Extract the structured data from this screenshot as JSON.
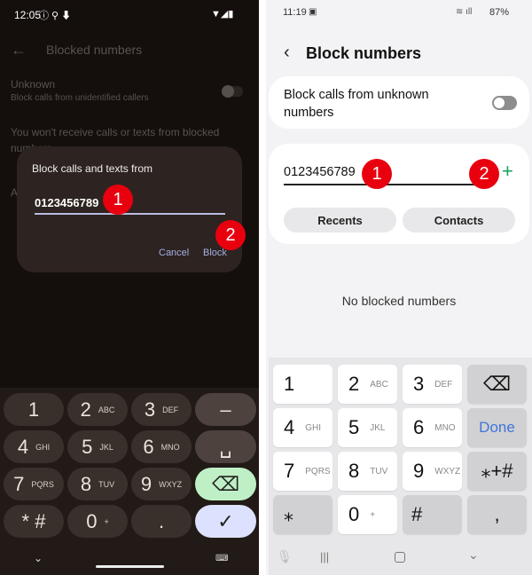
{
  "left": {
    "status": {
      "time": "12:05"
    },
    "title": "Blocked numbers",
    "unknown_label": "Unknown",
    "unknown_sub": "Block calls from unidentified callers",
    "info": "You won't receive calls or texts from blocked",
    "info2": "numbers",
    "info3": "A",
    "dialog": {
      "title": "Block calls and texts from",
      "value": "0123456789",
      "cancel": "Cancel",
      "block": "Block"
    },
    "keys": [
      {
        "d": "1",
        "l": ""
      },
      {
        "d": "2",
        "l": "ABC"
      },
      {
        "d": "3",
        "l": "DEF"
      },
      {
        "d": "–",
        "l": ""
      },
      {
        "d": "4",
        "l": "GHI"
      },
      {
        "d": "5",
        "l": "JKL"
      },
      {
        "d": "6",
        "l": "MNO"
      },
      {
        "d": "␣",
        "l": ""
      },
      {
        "d": "7",
        "l": "PQRS"
      },
      {
        "d": "8",
        "l": "TUV"
      },
      {
        "d": "9",
        "l": "WXYZ"
      },
      {
        "d": "⌫",
        "l": ""
      },
      {
        "d": "* #",
        "l": ""
      },
      {
        "d": "0",
        "l": "+"
      },
      {
        "d": ".",
        "l": ""
      },
      {
        "d": "✓",
        "l": ""
      }
    ]
  },
  "right": {
    "status": {
      "time": "11:19",
      "battery": "87%"
    },
    "title": "Block numbers",
    "unknown_toggle_label": "Block calls from unknown numbers",
    "input_value": "0123456789",
    "recents": "Recents",
    "contacts": "Contacts",
    "empty": "No blocked numbers",
    "accent": "#1aa260",
    "keys": [
      {
        "d": "1",
        "l": ""
      },
      {
        "d": "2",
        "l": "ABC"
      },
      {
        "d": "3",
        "l": "DEF"
      },
      {
        "d": "⌫",
        "l": ""
      },
      {
        "d": "4",
        "l": "GHI"
      },
      {
        "d": "5",
        "l": "JKL"
      },
      {
        "d": "6",
        "l": "MNO"
      },
      {
        "d": "Done",
        "l": ""
      },
      {
        "d": "7",
        "l": "PQRS"
      },
      {
        "d": "8",
        "l": "TUV"
      },
      {
        "d": "9",
        "l": "WXYZ"
      },
      {
        "d": "⁎+#",
        "l": ""
      },
      {
        "d": "⁎",
        "l": ""
      },
      {
        "d": "0",
        "l": "+"
      },
      {
        "d": "#",
        "l": ""
      },
      {
        "d": ",",
        "l": ""
      }
    ]
  },
  "badges": {
    "one": "1",
    "two": "2"
  }
}
